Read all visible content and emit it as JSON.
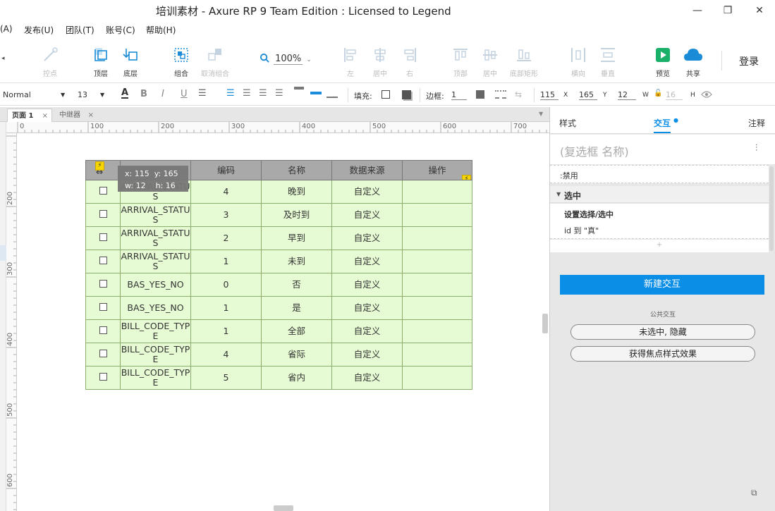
{
  "window": {
    "title": "培训素材 - Axure RP 9 Team Edition : Licensed to Legend",
    "min": "—",
    "max": "❐",
    "close": "✕"
  },
  "menu": [
    "(A)",
    "发布(U)",
    "团队(T)",
    "账号(C)",
    "帮助(H)"
  ],
  "toolbar": {
    "items": [
      {
        "label": "控点",
        "icon": "anchor-icon",
        "disabled": true
      },
      {
        "label": "顶层",
        "icon": "bring-to-front-icon",
        "disabled": false
      },
      {
        "label": "底层",
        "icon": "send-to-back-icon",
        "disabled": false
      },
      {
        "label": "组合",
        "icon": "group-icon",
        "disabled": false
      },
      {
        "label": "取消组合",
        "icon": "ungroup-icon",
        "disabled": true
      },
      {
        "label": "左",
        "icon": "align-left-icon",
        "disabled": true
      },
      {
        "label": "居中",
        "icon": "align-center-icon",
        "disabled": true
      },
      {
        "label": "右",
        "icon": "align-right-icon",
        "disabled": true
      },
      {
        "label": "顶部",
        "icon": "align-top-icon",
        "disabled": true
      },
      {
        "label": "居中",
        "icon": "align-middle-icon",
        "disabled": true
      },
      {
        "label": "底部矩形",
        "icon": "align-bottom-icon",
        "disabled": true
      },
      {
        "label": "横向",
        "icon": "distribute-horizontal-icon",
        "disabled": true
      },
      {
        "label": "垂直",
        "icon": "distribute-vertical-icon",
        "disabled": true
      },
      {
        "label": "预览",
        "icon": "preview-icon",
        "disabled": false
      },
      {
        "label": "共享",
        "icon": "share-cloud-icon",
        "disabled": false
      }
    ],
    "zoom": "100%",
    "login": "登录"
  },
  "format": {
    "style": "Normal",
    "font_size": "13",
    "fill_label": "填充:",
    "border_label": "边框:",
    "border_width": "1",
    "x": "115",
    "x_label": "X",
    "y": "165",
    "y_label": "Y",
    "w": "12",
    "w_label": "W",
    "h": "16",
    "h_label": "H"
  },
  "tabs": [
    {
      "label": "页面 1"
    },
    {
      "label": "中继器"
    }
  ],
  "ruler": {
    "h": [
      "0",
      "100",
      "200",
      "300",
      "400",
      "500",
      "600",
      "700"
    ],
    "v": [
      "200",
      "300",
      "400",
      "500",
      "600"
    ]
  },
  "repeater": {
    "headers": [
      "",
      "",
      "编码",
      "名称",
      "数据来源",
      "操作"
    ],
    "rows": [
      {
        "code": "ARRIVAL_STATUS",
        "num": "4",
        "name": "晚到",
        "src": "自定义"
      },
      {
        "code": "ARRIVAL_STATUS",
        "num": "3",
        "name": "及时到",
        "src": "自定义"
      },
      {
        "code": "ARRIVAL_STATUS",
        "num": "2",
        "name": "早到",
        "src": "自定义"
      },
      {
        "code": "ARRIVAL_STATUS",
        "num": "1",
        "name": "未到",
        "src": "自定义"
      },
      {
        "code": "BAS_YES_NO",
        "num": "0",
        "name": "否",
        "src": "自定义"
      },
      {
        "code": "BAS_YES_NO",
        "num": "1",
        "name": "是",
        "src": "自定义"
      },
      {
        "code": "BILL_CODE_TYPE",
        "num": "1",
        "name": "全部",
        "src": "自定义"
      },
      {
        "code": "BILL_CODE_TYPE",
        "num": "4",
        "name": "省际",
        "src": "自定义"
      },
      {
        "code": "BILL_CODE_TYPE",
        "num": "5",
        "name": "省内",
        "src": "自定义"
      }
    ]
  },
  "tooltip": {
    "x": "x: 115",
    "y": "y: 165",
    "w": "w: 12",
    "h": "h: 16"
  },
  "panel": {
    "tabs": [
      "样式",
      "交互",
      "注释"
    ],
    "active_tab": "交互",
    "widget_name_placeholder": "(复选框 名称)",
    "disabled_row": ":禁用",
    "event": "选中",
    "action": "设置选择/选中",
    "action_detail": "id 到 \"真\"",
    "new_interaction": "新建交互",
    "common_label": "公共交互",
    "common": [
      "未选中, 隐藏",
      "获得焦点样式效果"
    ]
  },
  "colors": {
    "accent": "#0b8ee6",
    "row_bg": "#e6fbd3",
    "header_bg": "#a9a9a9"
  }
}
